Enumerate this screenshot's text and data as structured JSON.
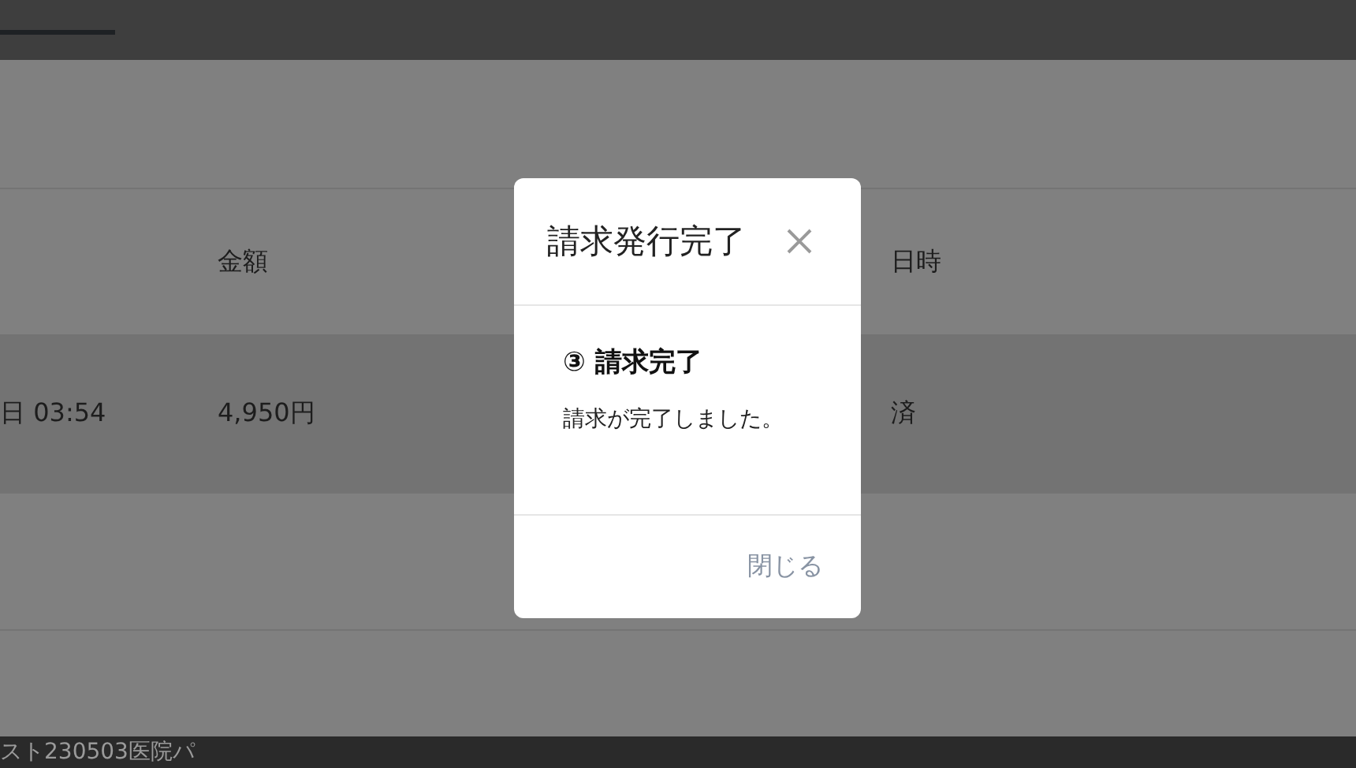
{
  "header": {
    "tabs": [
      {
        "selected": true
      }
    ]
  },
  "table": {
    "columns": [
      "",
      "金額",
      "日時"
    ],
    "rows": [
      {
        "cells": [
          "日 03:54",
          "4,950円",
          "済"
        ],
        "selected": true
      }
    ]
  },
  "footer_row": {
    "cells": [
      "スト230503医院パ"
    ]
  },
  "dialog": {
    "title": "請求発行完了",
    "step": "③ 請求完了",
    "message": "請求が完了しました。",
    "buttons": [
      "閉じる"
    ]
  }
}
